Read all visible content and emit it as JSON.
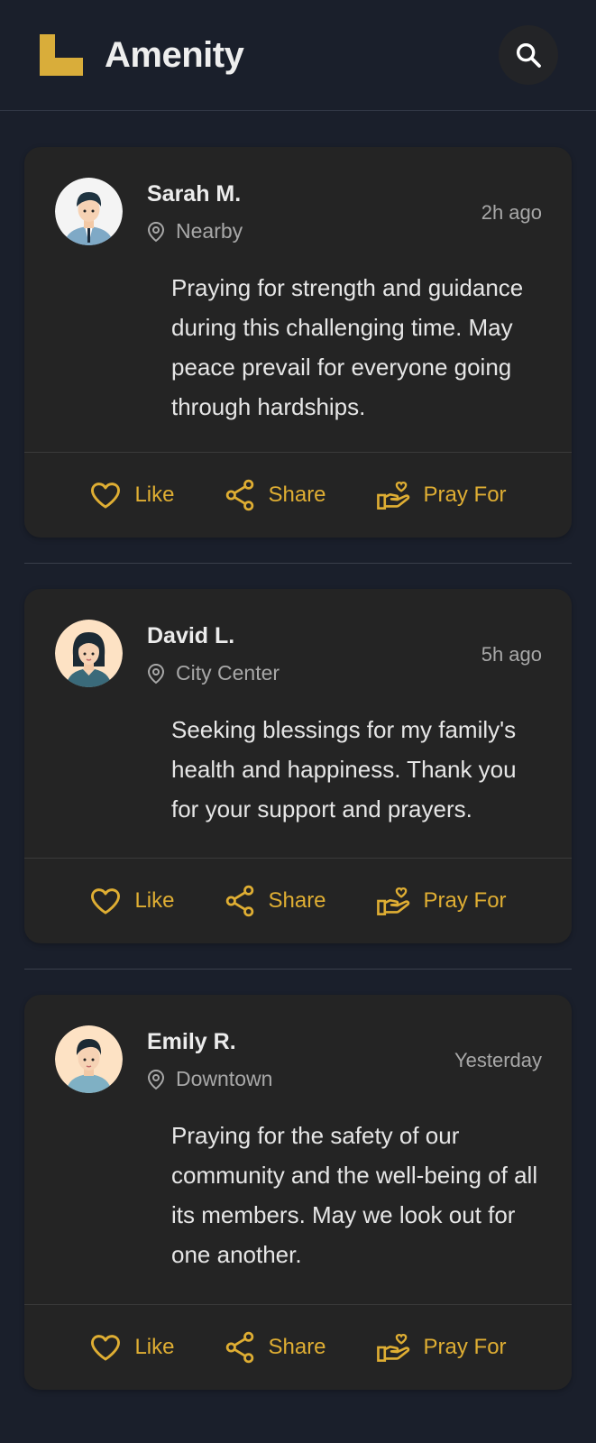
{
  "app": {
    "title": "Amenity",
    "accent": "#dfae33"
  },
  "header": {
    "search_icon": "search-icon",
    "logo_icon": "amenity-logo"
  },
  "posts": [
    {
      "author": "Sarah M.",
      "location": "Nearby",
      "time": "2h ago",
      "text": "Praying for strength and guidance during this challenging time. May peace prevail for everyone going through hardships.",
      "actions": {
        "like": "Like",
        "share": "Share",
        "pray": "Pray For"
      }
    },
    {
      "author": "David L.",
      "location": "City Center",
      "time": "5h ago",
      "text": "Seeking blessings for my family's health and happiness. Thank you for your support and prayers.",
      "actions": {
        "like": "Like",
        "share": "Share",
        "pray": "Pray For"
      }
    },
    {
      "author": "Emily R.",
      "location": "Downtown",
      "time": "Yesterday",
      "text": "Praying for the safety of our community and the well-being of all its members. May we look out for one another.",
      "actions": {
        "like": "Like",
        "share": "Share",
        "pray": "Pray For"
      }
    }
  ]
}
